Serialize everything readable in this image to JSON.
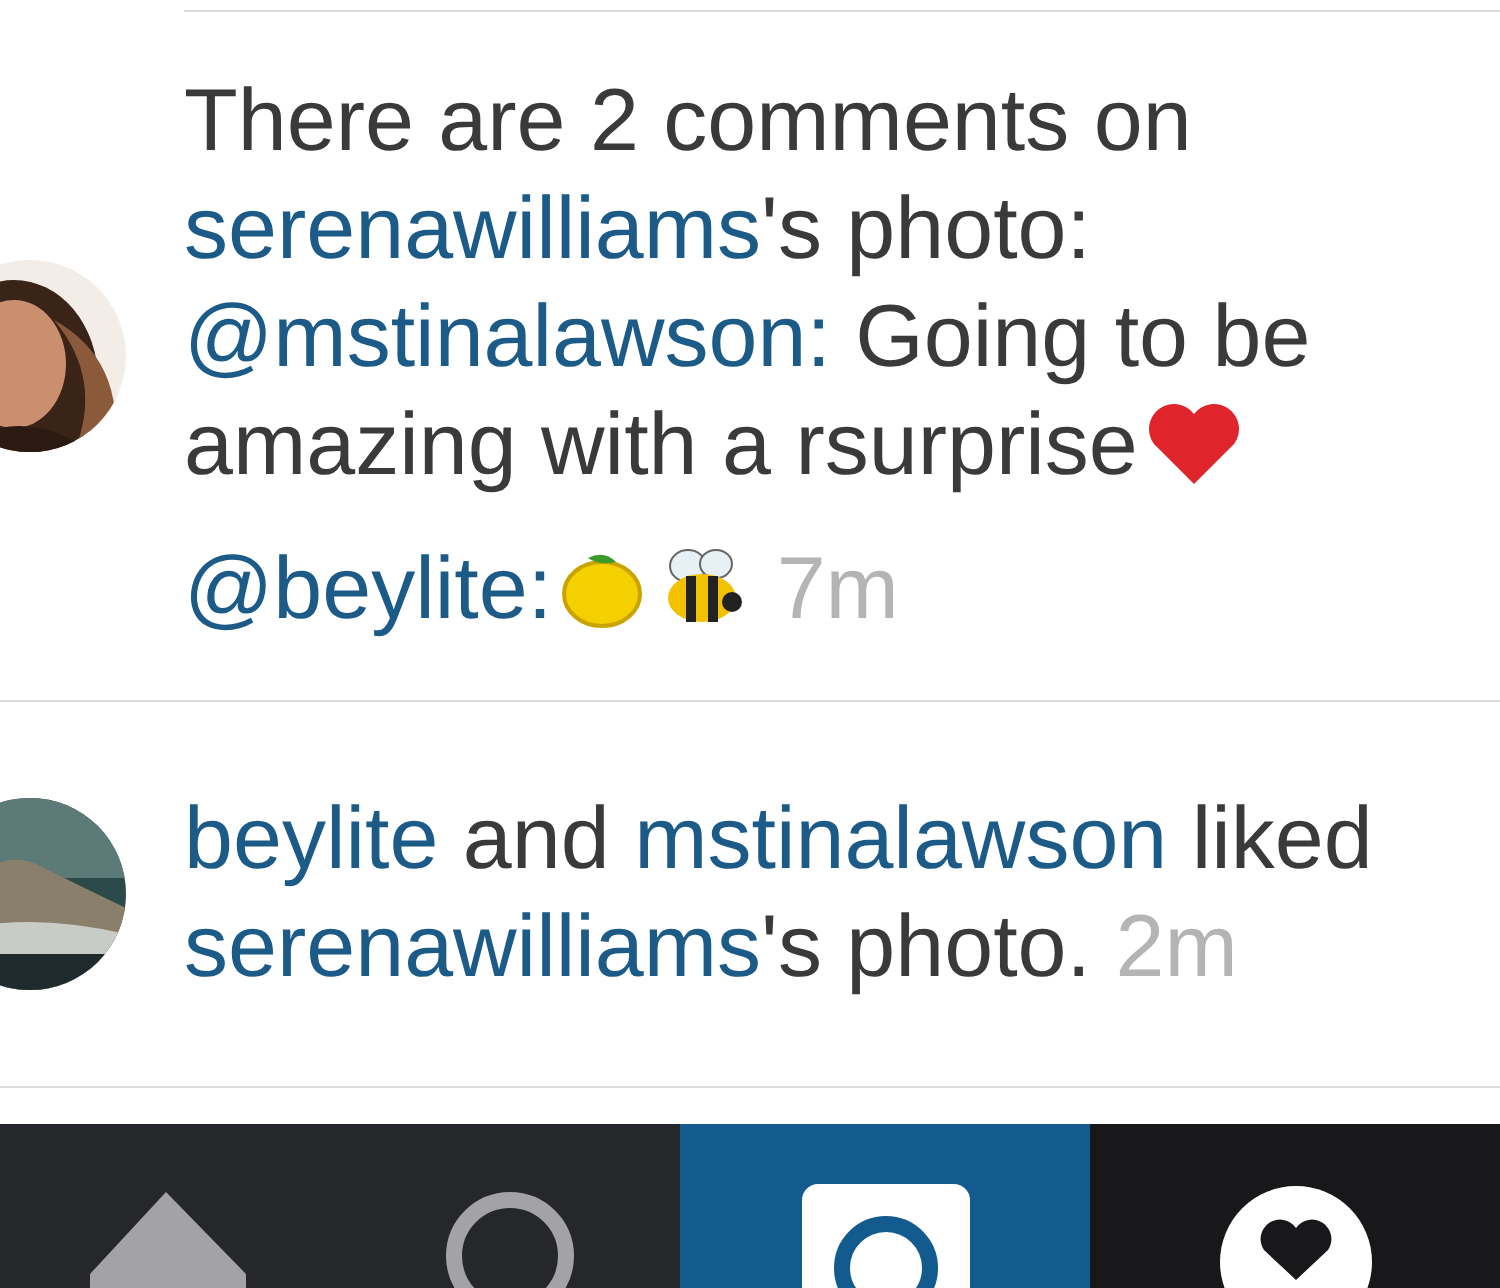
{
  "activity": [
    {
      "kind": "comments",
      "intro_before": "There are 2 comments on",
      "owner": "serenawilliams",
      "intro_after": "'s photo:",
      "comments": [
        {
          "user": "@mstinalawson:",
          "text": "Going to be amazing with a rsurprise",
          "emojis": [
            {
              "kind": "heart"
            }
          ]
        },
        {
          "user": "@beylite:",
          "emojis": [
            {
              "kind": "lemon"
            },
            {
              "kind": "bee"
            }
          ]
        }
      ],
      "time": "7m"
    },
    {
      "kind": "likes",
      "users": [
        "beylite",
        "mstinalawson"
      ],
      "joiner": "and",
      "verb": "liked",
      "owner": "serenawilliams",
      "after": "'s photo.",
      "time": "2m"
    }
  ],
  "tab_bar": [
    {
      "kind": "home",
      "selected": false
    },
    {
      "kind": "search",
      "selected": false
    },
    {
      "kind": "camera",
      "selected": false
    },
    {
      "kind": "activity",
      "selected": true
    }
  ]
}
